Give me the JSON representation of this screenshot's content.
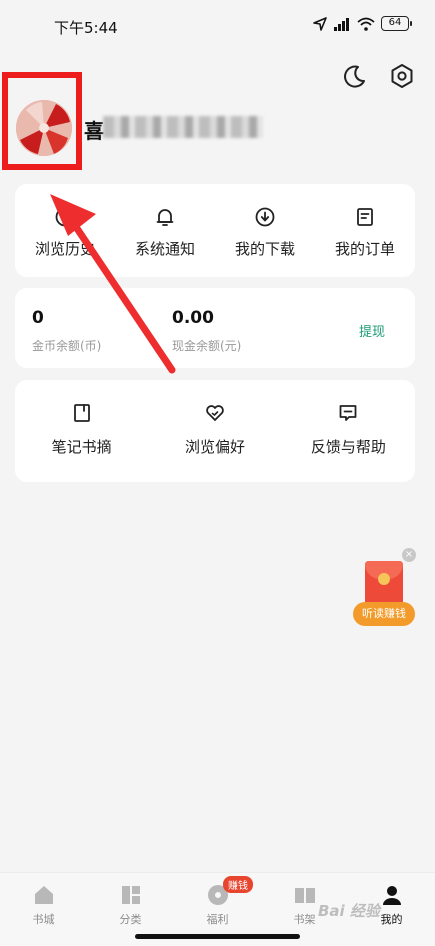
{
  "status_bar": {
    "time": "下午5:44",
    "battery": "64"
  },
  "profile": {
    "nickname_visible": "喜"
  },
  "quick_actions": [
    {
      "label": "浏览历史",
      "icon": "history-icon"
    },
    {
      "label": "系统通知",
      "icon": "bell-icon"
    },
    {
      "label": "我的下载",
      "icon": "download-icon"
    },
    {
      "label": "我的订单",
      "icon": "order-icon"
    }
  ],
  "balance": {
    "coin_value": "0",
    "coin_label": "金币余额(币)",
    "cash_value": "0.00",
    "cash_label": "现金余额(元)",
    "withdraw_label": "提现"
  },
  "tools": [
    {
      "label": "笔记书摘",
      "icon": "note-icon"
    },
    {
      "label": "浏览偏好",
      "icon": "heart-icon"
    },
    {
      "label": "反馈与帮助",
      "icon": "feedback-icon"
    }
  ],
  "floating": {
    "pill_label": "听读赚钱",
    "close_glyph": "×"
  },
  "bottom_nav": [
    {
      "label": "书城",
      "icon": "home-icon",
      "active": false
    },
    {
      "label": "分类",
      "icon": "category-icon",
      "active": false
    },
    {
      "label": "福利",
      "icon": "gift-icon",
      "active": false,
      "badge": "赚钱"
    },
    {
      "label": "书架",
      "icon": "bookshelf-icon",
      "active": false
    },
    {
      "label": "我的",
      "icon": "profile-icon",
      "active": true
    }
  ],
  "watermark": "Bai 经验",
  "colors": {
    "accent_green": "#1a9b74",
    "highlight_red": "#ee1d1d",
    "badge_red": "#e8452f",
    "pill_orange": "#f39b2a"
  }
}
